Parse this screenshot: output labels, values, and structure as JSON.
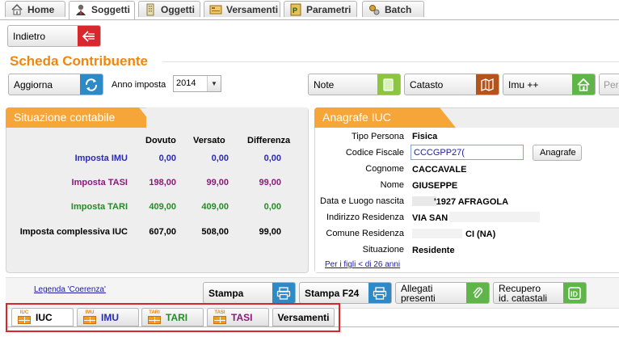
{
  "top_tabs": [
    {
      "label": "Home",
      "icon": "home-icon"
    },
    {
      "label": "Soggetti",
      "icon": "user-icon"
    },
    {
      "label": "Oggetti",
      "icon": "building-icon"
    },
    {
      "label": "Versamenti",
      "icon": "payments-icon"
    },
    {
      "label": "Parametri",
      "icon": "parameters-icon"
    },
    {
      "label": "Batch",
      "icon": "batch-icon"
    }
  ],
  "back_button": "Indietro",
  "page_title": "Scheda Contribuente",
  "refresh_button": "Aggiorna",
  "year_label": "Anno imposta",
  "year_value": "2014",
  "action_buttons": {
    "note": "Note",
    "catasto": "Catasto",
    "imu": "Imu ++",
    "truncated": "Per"
  },
  "situazione": {
    "title": "Situazione contabile",
    "headers": [
      "Dovuto",
      "Versato",
      "Differenza"
    ],
    "rows": [
      {
        "label": "Imposta IMU",
        "dovuto": "0,00",
        "versato": "0,00",
        "differenza": "0,00",
        "color": "#2b2bb0"
      },
      {
        "label": "Imposta TASI",
        "dovuto": "198,00",
        "versato": "99,00",
        "differenza": "99,00",
        "color": "#8a1a7a"
      },
      {
        "label": "Imposta TARI",
        "dovuto": "409,00",
        "versato": "409,00",
        "differenza": "0,00",
        "color": "#268a26"
      },
      {
        "label": "Imposta complessiva IUC",
        "dovuto": "607,00",
        "versato": "508,00",
        "differenza": "99,00",
        "color": "#000000"
      }
    ]
  },
  "anagrafe": {
    "title": "Anagrafe IUC",
    "fields": [
      {
        "label": "Tipo Persona",
        "value": "Fisica"
      },
      {
        "label": "Codice Fiscale",
        "value": "CCCGPP27("
      },
      {
        "label": "Cognome",
        "value": "CACCAVALE"
      },
      {
        "label": "Nome",
        "value": "GIUSEPPE"
      },
      {
        "label": "Data e Luogo nascita",
        "value": "'1927 AFRAGOLA"
      },
      {
        "label": "Indirizzo Residenza",
        "value": "VIA SAN"
      },
      {
        "label": "Comune Residenza",
        "value": "CI (NA)"
      },
      {
        "label": "Situazione",
        "value": "Residente"
      }
    ],
    "anagrafe_button": "Anagrafe",
    "figli_link": "Per i figli < di 26 anni"
  },
  "legenda_link": "Legenda 'Coerenza'",
  "bottom_buttons": {
    "stampa": "Stampa",
    "stampa_f24": "Stampa F24",
    "allegati_1": "Allegati",
    "allegati_2": "presenti",
    "recupero_1": "Recupero",
    "recupero_2": "id. catastali"
  },
  "bottom_tabs": [
    {
      "label": "IUC",
      "badge": "IUC",
      "color": "#000000"
    },
    {
      "label": "IMU",
      "badge": "IMU",
      "color": "#2b2bb0"
    },
    {
      "label": "TARI",
      "badge": "TARI",
      "color": "#268a26"
    },
    {
      "label": "TASI",
      "badge": "TASI",
      "color": "#8a1a7a"
    },
    {
      "label": "Versamenti",
      "badge": "",
      "color": "#000000"
    }
  ],
  "colors": {
    "accent_orange": "#f0860f",
    "panel_tab": "#f6a638",
    "highlight_border": "#d9262b"
  }
}
